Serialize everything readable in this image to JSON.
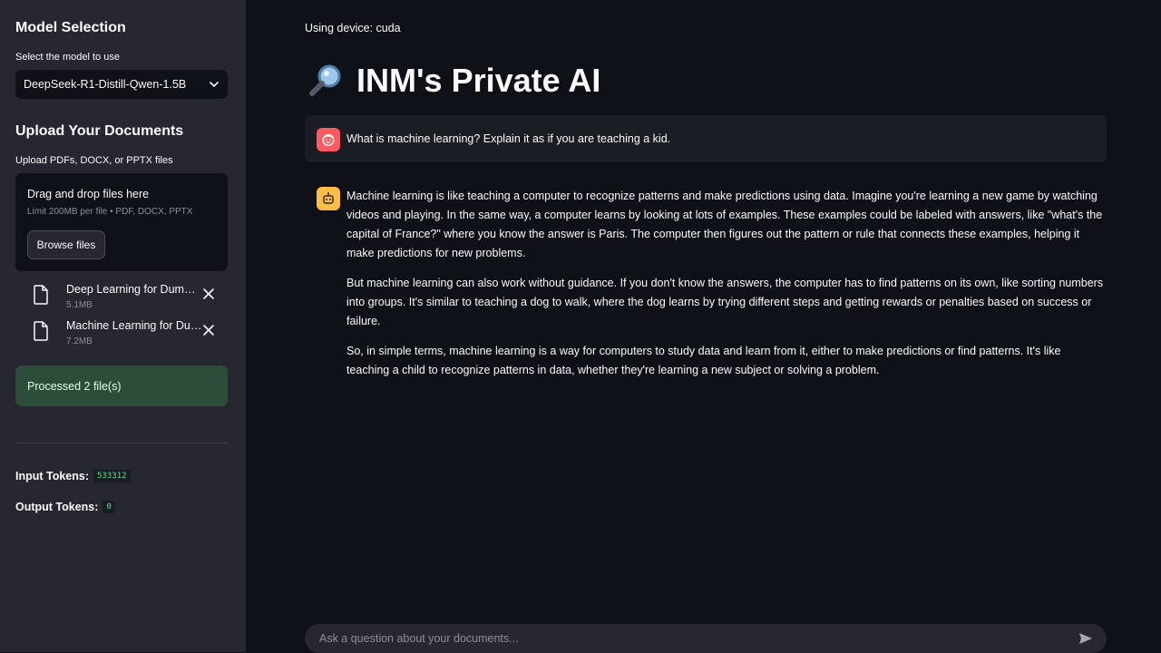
{
  "sidebar": {
    "model_heading": "Model Selection",
    "model_label": "Select the model to use",
    "model_selected": "DeepSeek-R1-Distill-Qwen-1.5B",
    "upload_heading": "Upload Your Documents",
    "upload_label": "Upload PDFs, DOCX, or PPTX files",
    "dropzone": {
      "title": "Drag and drop files here",
      "limit": "Limit 200MB per file • PDF, DOCX, PPTX",
      "browse_label": "Browse files"
    },
    "files": [
      {
        "name": "Deep Learning for Dummies.pdf",
        "display": "Deep Learning for Dumm…",
        "size": "5.1MB"
      },
      {
        "name": "Machine Learning for Dummies.pdf",
        "display": "Machine Learning for Du…",
        "size": "7.2MB"
      }
    ],
    "status": "Processed 2 file(s)",
    "input_tokens_label": "Input Tokens:",
    "input_tokens": "533312",
    "output_tokens_label": "Output Tokens:",
    "output_tokens": "0"
  },
  "main": {
    "device": "Using device: cuda",
    "title": "INM's Private AI",
    "title_icon": "magnifier-icon",
    "user_message": "What is machine learning? Explain it as if you are teaching a kid.",
    "assistant_paragraphs": [
      "Machine learning is like teaching a computer to recognize patterns and make predictions using data. Imagine you're learning a new game by watching videos and playing. In the same way, a computer learns by looking at lots of examples. These examples could be labeled with answers, like \"what's the capital of France?\" where you know the answer is Paris. The computer then figures out the pattern or rule that connects these examples, helping it make predictions for new problems.",
      "But machine learning can also work without guidance. If you don't know the answers, the computer has to find patterns on its own, like sorting numbers into groups. It's similar to teaching a dog to walk, where the dog learns by trying different steps and getting rewards or penalties based on success or failure.",
      "So, in simple terms, machine learning is a way for computers to study data and learn from it, either to make predictions or find patterns. It's like teaching a child to recognize patterns in data, whether they're learning a new subject or solving a problem."
    ],
    "chat_placeholder": "Ask a question about your documents..."
  },
  "colors": {
    "background": "#0e1117",
    "sidebar": "#262730",
    "user_avatar": "#ff5a5f",
    "assistant_avatar": "#ffbd45",
    "success_bg": "#2c4d3a",
    "token_value": "#5ce488"
  }
}
